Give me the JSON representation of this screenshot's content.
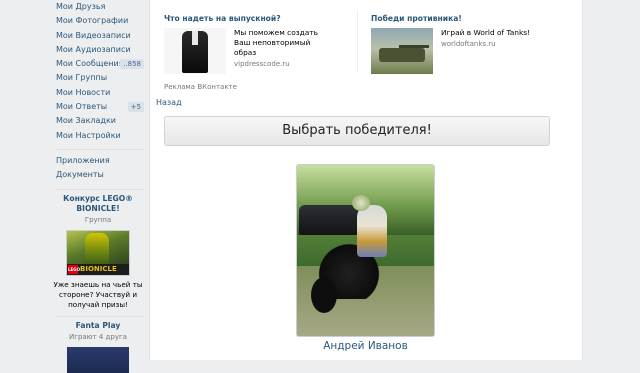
{
  "sidebar": {
    "items": [
      {
        "label": "Мои Друзья"
      },
      {
        "label": "Мои Фотографии"
      },
      {
        "label": "Мои Видеозаписи"
      },
      {
        "label": "Мои Аудиозаписи"
      },
      {
        "label": "Мои Сообщения",
        "badge": "..858"
      },
      {
        "label": "Мои Группы"
      },
      {
        "label": "Мои Новости"
      },
      {
        "label": "Мои Ответы",
        "badge": "+5"
      },
      {
        "label": "Мои Закладки"
      },
      {
        "label": "Мои Настройки"
      }
    ],
    "extra": [
      {
        "label": "Приложения"
      },
      {
        "label": "Документы"
      }
    ],
    "promo1": {
      "title": "Конкурс LEGO® BIONICLE!",
      "subtitle": "Группа",
      "image_label": "BIONICLE",
      "lego_logo": "LEGO",
      "text": "Уже знаешь на чьей ты стороне? Участвуй и получай призы!"
    },
    "promo2": {
      "title": "Fanta Play",
      "subtitle": "Играют 4 друга"
    }
  },
  "ads": {
    "left": {
      "title": "Что надеть на выпускной?",
      "text": "Мы поможем создать Ваш неповторимый образ",
      "link": "vipdresscode.ru"
    },
    "right": {
      "title": "Победи противника!",
      "text": "Играй в World of Tanks!",
      "link": "worldoftanks.ru"
    },
    "footer": "Реклама ВКонтакте"
  },
  "back_link": "Назад",
  "winner_button": "Выбрать победителя!",
  "photo": {
    "caption": "Андрей Иванов"
  },
  "colors": {
    "link": "#2b587a",
    "background": "#edeef0",
    "panel": "#ffffff",
    "badge": "#dae2e8"
  },
  "icons": {
    "lego_logo": "lego-logo-icon"
  }
}
